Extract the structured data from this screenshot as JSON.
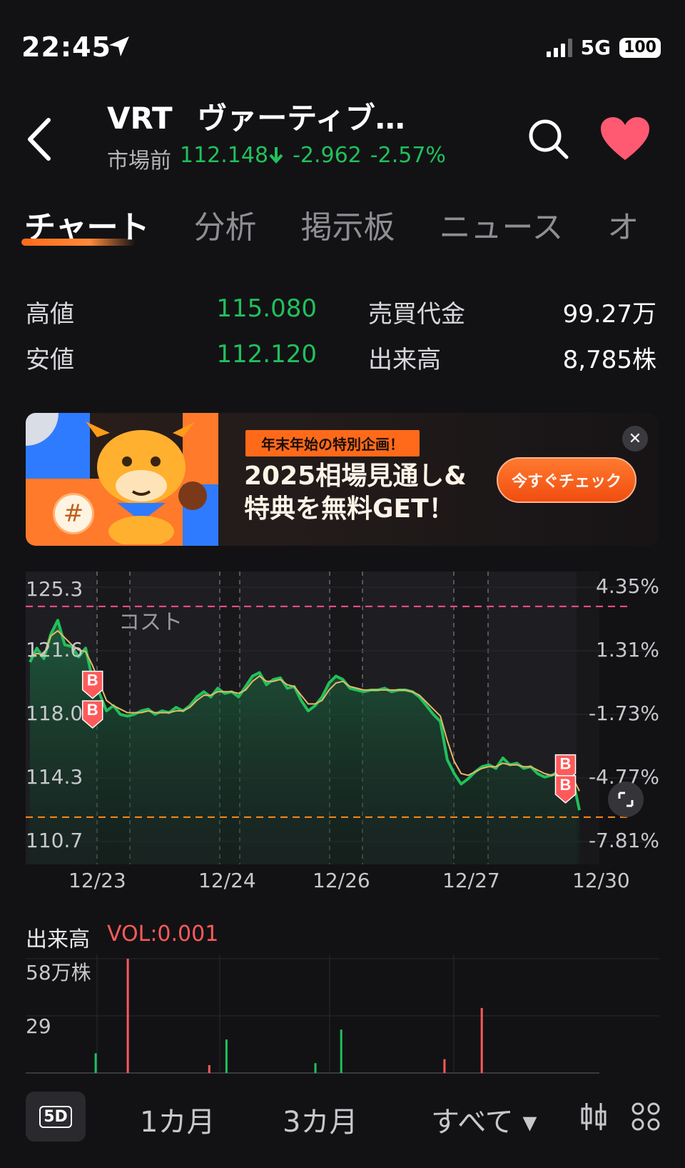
{
  "status": {
    "time": "22:45",
    "network": "5G",
    "battery": "100"
  },
  "header": {
    "ticker": "VRT",
    "name": "ヴァーティブ…",
    "session_label": "市場前",
    "price": "112.148",
    "change": "-2.962",
    "change_pct": "-2.57%",
    "up_color": "#ff5a5a",
    "down_color": "#21c05b"
  },
  "tabs": [
    {
      "label": "チャート",
      "active": true
    },
    {
      "label": "分析"
    },
    {
      "label": "掲示板"
    },
    {
      "label": "ニュース"
    },
    {
      "label": "オ"
    }
  ],
  "stats": {
    "high_label": "高値",
    "high": "115.080",
    "low_label": "安値",
    "low": "112.120",
    "turnover_label": "売買代金",
    "turnover": "99.27万",
    "volume_label": "出来高",
    "volume": "8,785株"
  },
  "banner": {
    "tag": "年末年始の特別企画！",
    "headline_1": "2025相場見通し&",
    "headline_2": "特典を無料GET！",
    "cta": "今すぐチェック",
    "close": "✕",
    "badge": "#"
  },
  "chart_data": [
    {
      "type": "line",
      "y_ticks_left": [
        "125.3",
        "121.6",
        "118.0",
        "114.3",
        "110.7"
      ],
      "y_ticks_right": [
        "4.35%",
        "1.31%",
        "-1.73%",
        "-4.77%",
        "-7.81%"
      ],
      "ylim": [
        110.7,
        125.3
      ],
      "x_ticks": [
        "12/23",
        "12/24",
        "12/26",
        "12/27",
        "12/30"
      ],
      "cost_label": "コスト",
      "cost_line": 124.2,
      "low_line": 112.1,
      "buy_marker": "B",
      "series": [
        {
          "values": [
            121.0,
            121.8,
            121.2,
            122.6,
            123.4,
            122.0,
            121.9,
            121.3,
            121.8,
            120.0,
            119.2,
            118.2,
            118.5,
            118.0,
            117.9,
            118.0,
            118.2,
            118.3,
            118.0,
            118.2,
            118.1,
            118.4,
            118.2,
            118.5,
            119.0,
            119.3,
            119.0,
            119.5,
            119.2,
            119.3,
            119.0,
            119.6,
            120.2,
            120.4,
            119.7,
            120.0,
            120.1,
            119.5,
            119.6,
            118.8,
            118.2,
            118.5,
            119.0,
            119.8,
            120.2,
            120.0,
            119.5,
            119.4,
            119.3,
            119.4,
            119.4,
            119.5,
            119.3,
            119.4,
            119.4,
            119.3,
            119.0,
            118.5,
            118.0,
            117.6,
            115.4,
            114.6,
            114.0,
            114.3,
            114.7,
            115.0,
            115.1,
            114.9,
            115.5,
            115.1,
            115.2,
            114.9,
            115.0,
            114.6,
            114.4,
            114.5,
            114.7,
            114.3,
            114.4,
            112.5
          ],
          "color": "#21c05b"
        },
        {
          "values": [
            121.3,
            121.5,
            121.4,
            122.5,
            122.8,
            122.4,
            122.0,
            121.7,
            121.6,
            120.8,
            119.8,
            118.8,
            118.5,
            118.3,
            118.1,
            118.1,
            118.1,
            118.2,
            118.1,
            118.1,
            118.1,
            118.2,
            118.2,
            118.4,
            118.8,
            119.1,
            119.1,
            119.3,
            119.3,
            119.3,
            119.2,
            119.4,
            119.9,
            120.2,
            119.9,
            119.9,
            120.0,
            119.7,
            119.6,
            119.1,
            118.6,
            118.6,
            118.8,
            119.4,
            119.8,
            119.9,
            119.6,
            119.5,
            119.4,
            119.4,
            119.4,
            119.4,
            119.4,
            119.4,
            119.4,
            119.3,
            119.1,
            118.7,
            118.3,
            117.9,
            116.5,
            115.3,
            114.6,
            114.5,
            114.7,
            114.9,
            115.0,
            115.0,
            115.2,
            115.1,
            115.1,
            115.0,
            115.0,
            114.8,
            114.6,
            114.5,
            114.6,
            114.4,
            114.4,
            113.6
          ],
          "color": "#e8b86a"
        }
      ]
    },
    {
      "type": "bar",
      "title": "出来高",
      "vol_label": "VOL:0.001",
      "y_ticks": [
        "58万株",
        "29"
      ],
      "ylim": [
        0,
        58
      ],
      "x": [
        12.2,
        17.8,
        32.0,
        35.0,
        50.5,
        55.0,
        73.0,
        79.5
      ],
      "values": [
        10,
        58,
        4,
        17,
        5,
        22,
        7,
        33
      ],
      "colors": [
        "#21c05b",
        "#ff5a5a",
        "#ff5a5a",
        "#21c05b",
        "#21c05b",
        "#21c05b",
        "#ff5a5a",
        "#ff5a5a"
      ]
    }
  ],
  "periods": {
    "d5": "5D",
    "m1": "1カ月",
    "m3": "3カ月",
    "all": "すべて ▾"
  }
}
